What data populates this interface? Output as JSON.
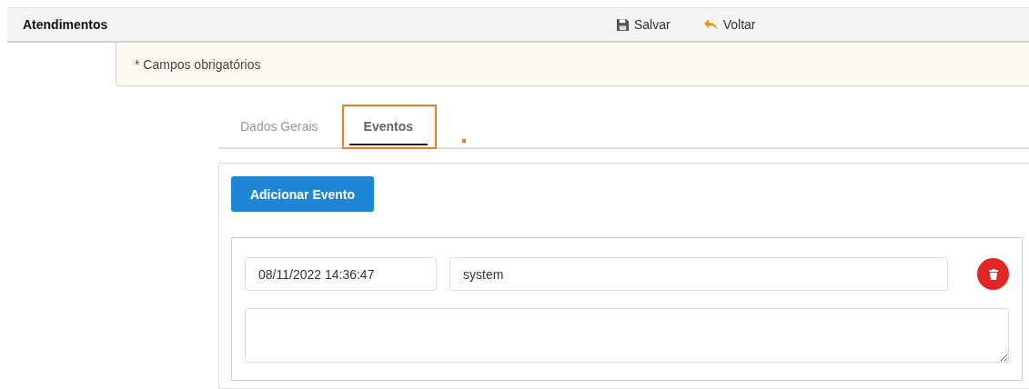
{
  "header": {
    "title": "Atendimentos",
    "actions": [
      {
        "kind": "save",
        "label": "Salvar"
      },
      {
        "kind": "back",
        "label": "Voltar"
      }
    ]
  },
  "notice": "* Campos obrigatórios",
  "tabs": [
    {
      "label": "Dados Gerais",
      "selected": false,
      "highlighted": false
    },
    {
      "label": "Eventos",
      "selected": true,
      "highlighted": true
    }
  ],
  "add_button": "Adicionar Evento",
  "events": [
    {
      "datetime": "08/11/2022 14:36:47",
      "user": "system"
    }
  ]
}
